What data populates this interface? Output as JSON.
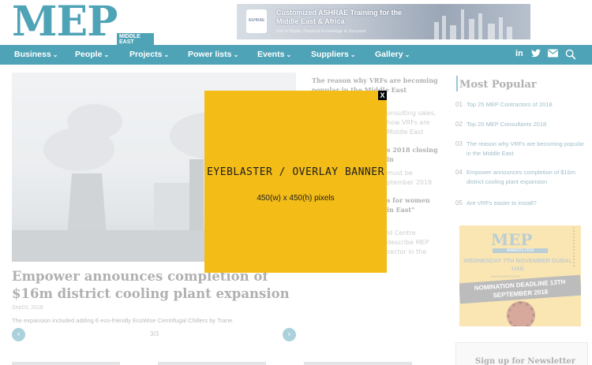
{
  "logo": {
    "text": "MEP",
    "sub": "MIDDLE EAST"
  },
  "banner_ad": {
    "badge": "ASHRAE",
    "title": "Customized ASHRAE Training for the Middle East & Africa",
    "subtitle": "Get In Depth, Practical Knowledge to Succeed"
  },
  "nav": {
    "items": [
      {
        "label": "Business"
      },
      {
        "label": "People"
      },
      {
        "label": "Projects"
      },
      {
        "label": "Power lists"
      },
      {
        "label": "Events"
      },
      {
        "label": "Suppliers"
      },
      {
        "label": "Gallery"
      }
    ],
    "chevron": "⌄",
    "social": {
      "linkedin": "in",
      "twitter": "twitter-icon",
      "email": "mail-icon",
      "search": "search-icon"
    }
  },
  "featured": {
    "title": "Empower announces completion of $16m district cooling plant expansion",
    "date": "Sep03, 2018",
    "description": "The expansion included adding 6 eco-friendly EcoWise Centrifugal Chillers by Trane.",
    "pager": "3/3",
    "prev": "‹",
    "next": "›"
  },
  "middle": {
    "items": [
      {
        "title": "The reason why VRFs are becoming popular in the Middle East"
      },
      {
        "text": "onsulting sales, how VRFs are Middle East"
      },
      {
        "title": "s 2018 closing in"
      },
      {
        "text": "must be ptember 2018"
      },
      {
        "title": "s for women in East\""
      },
      {
        "text": "ld Centre describe MEP sector in the"
      }
    ]
  },
  "most_popular": {
    "title": "Most Popular",
    "items": [
      {
        "num": "01",
        "text": "Top 25 MEP Contractors of 2018"
      },
      {
        "num": "02",
        "text": "Top 20 MEP Consultants 2018"
      },
      {
        "num": "03",
        "text": "The reason why VRFs are becoming popular in the Middle East"
      },
      {
        "num": "04",
        "text": "Empower announces completion of $16m district cooling plant expansion"
      },
      {
        "num": "05",
        "text": "Are VRFs easier to install?"
      }
    ]
  },
  "awards_ad": {
    "logo": "MEP",
    "sub": "AWARDS 2018",
    "date": "WEDNESDAY 7TH NOVEMBER DUBAI, UAE",
    "tag": "#MEPAWARDS2018",
    "deadline": "NOMINATION DEADLINE 13TH SEPTEMBER 2018"
  },
  "newsletter": {
    "title": "Sign up for Newsletter"
  },
  "overlay": {
    "close": "X",
    "title": "EYEBLASTER / OVERLAY BANNER",
    "size": "450(w) x 450(h) pixels",
    "color": "#f3bc17"
  }
}
